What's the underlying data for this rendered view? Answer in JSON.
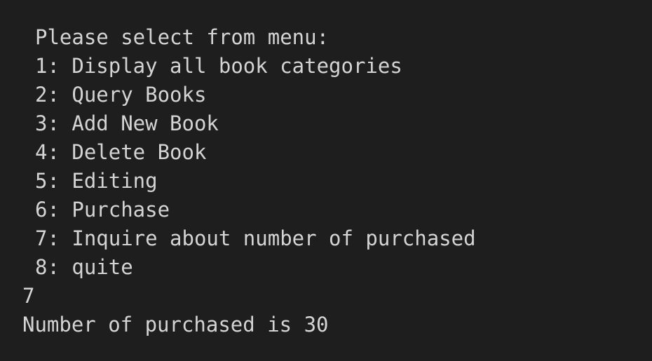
{
  "terminal": {
    "prompt": "Please select from menu:",
    "menu_items": [
      "1: Display all book categories",
      "2: Query Books",
      "3: Add New Book",
      "4: Delete Book",
      "5: Editing",
      "6: Purchase",
      "7: Inquire about number of purchased",
      "8: quite"
    ],
    "user_input": "7",
    "result": "Number of purchased is 30"
  },
  "colors": {
    "background": "#1e1e1e",
    "text": "#d4d4d4"
  }
}
